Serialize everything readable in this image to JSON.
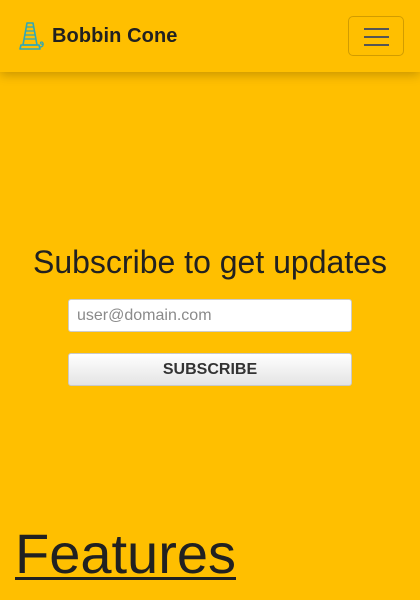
{
  "navbar": {
    "brand_name": "Bobbin Cone",
    "logo_icon": "thread-cone-icon",
    "toggle_icon": "hamburger-menu-icon"
  },
  "subscribe": {
    "title": "Subscribe to get updates",
    "email_placeholder": "user@domain.com",
    "email_value": "",
    "button_label": "SUBSCRIBE"
  },
  "features": {
    "heading": "Features"
  },
  "colors": {
    "background": "#ffbf00",
    "logo_accent": "#2fa8b8",
    "text": "#212121"
  }
}
